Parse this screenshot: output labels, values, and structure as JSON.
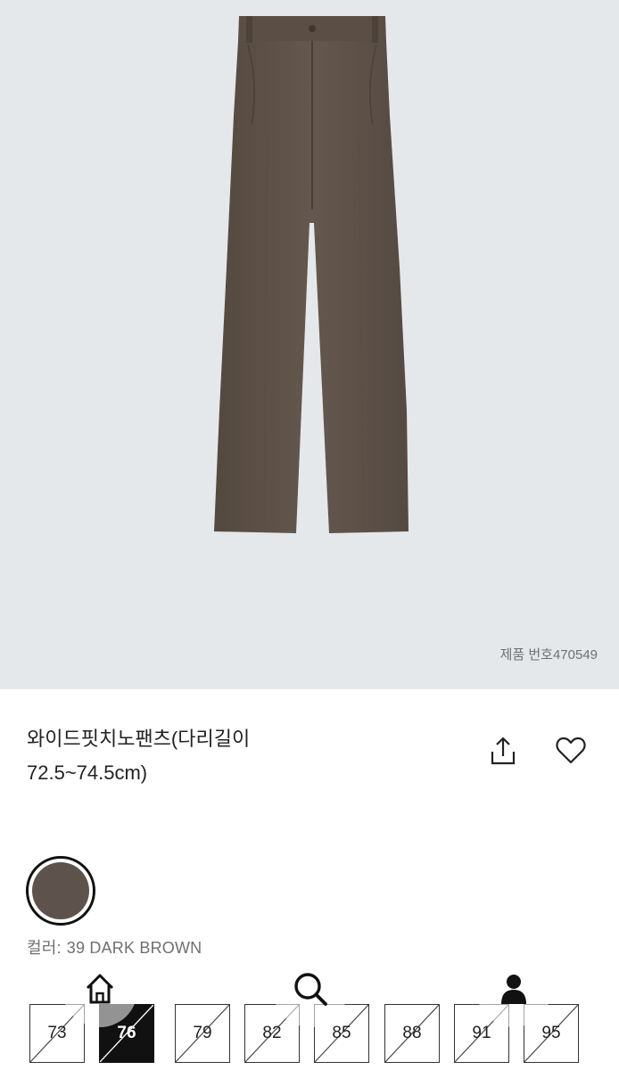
{
  "product": {
    "product_number": "제품 번호470549",
    "title_line1": "와이드핏치노팬츠(다리길이",
    "title_line2": "72.5~74.5cm)"
  },
  "color": {
    "label": "컬러:",
    "value": "39 DARK BROWN",
    "swatch_hex": "#5e534c"
  },
  "sizes": [
    {
      "label": "73",
      "selected": false,
      "sold_out": true
    },
    {
      "label": "76",
      "selected": true,
      "sold_out": true
    },
    {
      "label": "79",
      "selected": false,
      "sold_out": true
    },
    {
      "label": "82",
      "selected": false,
      "sold_out": true
    },
    {
      "label": "85",
      "selected": false,
      "sold_out": true
    },
    {
      "label": "88",
      "selected": false,
      "sold_out": true
    },
    {
      "label": "91",
      "selected": false,
      "sold_out": true
    },
    {
      "label": "95",
      "selected": false,
      "sold_out": true
    }
  ],
  "icons": {
    "share": "share-icon",
    "wishlist": "heart-icon",
    "nav_home": "home-icon",
    "nav_search": "search-icon",
    "nav_profile": "person-icon"
  },
  "colors": {
    "hero_background": "#e5e8ea",
    "pants": "#5e534c"
  }
}
